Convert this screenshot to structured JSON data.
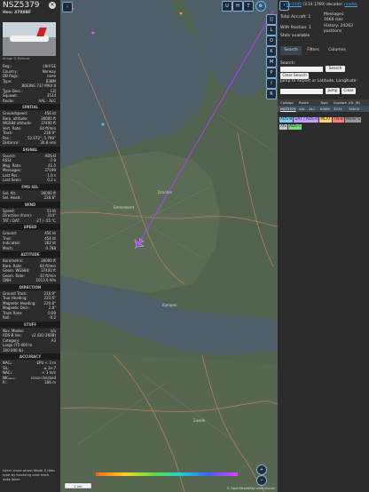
{
  "aircraft": {
    "callsign": "NSZ5379",
    "hex_line": "Hex: 4788BF",
    "photo_credit": "Image © Bjelovar",
    "rows_top": [
      {
        "k": "Reg.:",
        "v": "LN-FGE"
      },
      {
        "k": "Country:",
        "v": "Norway"
      },
      {
        "k": "DB flags:",
        "v": "none"
      },
      {
        "k": "Type:",
        "v": "B38M"
      },
      {
        "k": "",
        "v": "BOEING 737 MAX 8"
      },
      {
        "k": "Type Desc.:",
        "v": "L2J"
      },
      {
        "k": "Squawk:",
        "v": "3534"
      },
      {
        "k": "Route:",
        "v": "AAL - ALC"
      }
    ]
  },
  "sections": {
    "spatial": "SPATIAL",
    "signal": "SIGNAL",
    "fms": "FMS SEL",
    "wind": "WIND",
    "speed": "SPEED",
    "altitude": "ALTITUDE",
    "direction": "DIRECTION",
    "stuff": "STUFF",
    "accuracy": "ACCURACY"
  },
  "spatial_rows": [
    {
      "k": "Groundspeed:",
      "v": "456 kt"
    },
    {
      "k": "Baro. altitude:",
      "v": "36000 ft"
    },
    {
      "k": "WGS84 altitude:",
      "v": "37400 ft"
    },
    {
      "k": "Vert. Rate:",
      "v": "64 ft/min"
    },
    {
      "k": "Track:",
      "v": "216.9°"
    },
    {
      "k": "Pos.:",
      "v": "52.672°, 5.790°"
    },
    {
      "k": "Distance:",
      "v": "30.8 nmi"
    }
  ],
  "signal_rows": [
    {
      "k": "Source:",
      "v": "ADS-B"
    },
    {
      "k": "RSSI:",
      "v": "-7.8"
    },
    {
      "k": "Msg. Rate:",
      "v": "41.5"
    },
    {
      "k": "Messages:",
      "v": "37199"
    },
    {
      "k": "Last Pos.:",
      "v": "1.0 s"
    },
    {
      "k": "Last Seen:",
      "v": "0.2 s"
    }
  ],
  "fms_rows": [
    {
      "k": "Sel. Alt.:",
      "v": "36000 ft"
    },
    {
      "k": "Sel. Head.:",
      "v": "220.8°"
    }
  ],
  "wind_rows": [
    {
      "k": "Speed:",
      "v": "53 kt"
    },
    {
      "k": "Direction (from):",
      "v": "314°"
    },
    {
      "k": "TAT / OAT:",
      "v": "-27 / -55 °C"
    }
  ],
  "speed_rows": [
    {
      "k": "Ground:",
      "v": "456 kt"
    },
    {
      "k": "True:",
      "v": "454 kt"
    },
    {
      "k": "Indicated:",
      "v": "262 kt"
    },
    {
      "k": "Mach:",
      "v": "0.788"
    }
  ],
  "altitude_rows": [
    {
      "k": "Barometric:",
      "v": "36000 ft"
    },
    {
      "k": "Baro. Rate:",
      "v": "64 ft/min"
    },
    {
      "k": "Geom. WGS84:",
      "v": "37400 ft"
    },
    {
      "k": "Geom. Rate:",
      "v": "-32 ft/min"
    },
    {
      "k": "QNH:",
      "v": "1013.6 hPa"
    }
  ],
  "direction_rows": [
    {
      "k": "Ground Track:",
      "v": "216.9°"
    },
    {
      "k": "True Heading:",
      "v": "223.6°"
    },
    {
      "k": "Magnetic Heading:",
      "v": "220.8°"
    },
    {
      "k": "Magnetic Decl.:",
      "v": "2.8°"
    },
    {
      "k": "Track Rate:",
      "v": "0.00"
    },
    {
      "k": "Roll:",
      "v": "-0.2"
    }
  ],
  "stuff_rows": [
    {
      "k": "Nav. Modes:",
      "v": "n/a"
    },
    {
      "k": "ADS-B Ver.:",
      "v": "v2 (DO-260B)"
    },
    {
      "k": "Category:",
      "v": "A3"
    },
    {
      "k": "Large (75 000 to",
      "v": ""
    },
    {
      "k": "300 000 lb)",
      "v": ""
    }
  ],
  "accuracy_rows": [
    {
      "k": "NACₚ:",
      "v": "EPU < 3 m"
    },
    {
      "k": "SIL:",
      "v": "≤ 1e-7"
    },
    {
      "k": "NACᵥ:",
      "v": "< 3 m/s"
    },
    {
      "k": "NIC₆ₐₓₒ:",
      "v": "cross-checked"
    },
    {
      "k": "Rᶜ:",
      "v": "186 m"
    }
  ],
  "learn_more": "Learn more about Mode S data type by hovering over each data label.",
  "map": {
    "top_buttons": [
      "U",
      "H",
      "T"
    ],
    "side_buttons": [
      "L",
      "O",
      "K",
      "M",
      "P",
      "I",
      "R"
    ],
    "scale": "1 nm",
    "attribution": "© OpenStreetMap contributors",
    "zoom_in": "+",
    "zoom_out": "−",
    "town_labels": [
      "Emmeloord",
      "Dronten",
      "Kampen",
      "Zwolle"
    ]
  },
  "sidebar": {
    "version_link": "tar1090",
    "version_text": " (3.14.1769) decoder: ",
    "decoder_link": "readsb",
    "total_aircraft": "Total Aircraft: 1",
    "messages": "Messages:",
    "msg_rate": "1660 /sec",
    "with_position": "With Position: 1",
    "history": "History: 24263",
    "positions": "positions",
    "stats": "Stats available",
    "tabs": [
      "Search",
      "Filters",
      "Columns"
    ],
    "search_label": "Search:",
    "search_btn": "Search",
    "clear_btn": "Clear Search",
    "jump_label": "Jump to Airport or Latitude, Longitude:",
    "jump_btn": "Jump",
    "jump_clear": "Clear",
    "table_headers": [
      "Callsign",
      "Route",
      "Type",
      "Squawk",
      "Alt. (ft)"
    ],
    "table_row": [
      "NSZ5379",
      "AAL - ALC",
      "B38M",
      "3534",
      "36000"
    ],
    "legend": [
      "ADS-B",
      "UAT / ADS-R",
      "MLAT",
      "TIS-B",
      "Mode-S",
      "AIS",
      "ADS-C"
    ]
  },
  "colors": {
    "track": "#b040ff",
    "accent_link": "#4aa3ff",
    "adsb": "#7ec9ff",
    "uat": "#c0a0ff",
    "mlat": "#ffd070",
    "tisb": "#ff8080",
    "modes": "#9a9a9a",
    "ais": "#c9c9c9",
    "adsc": "#7fd57f"
  }
}
